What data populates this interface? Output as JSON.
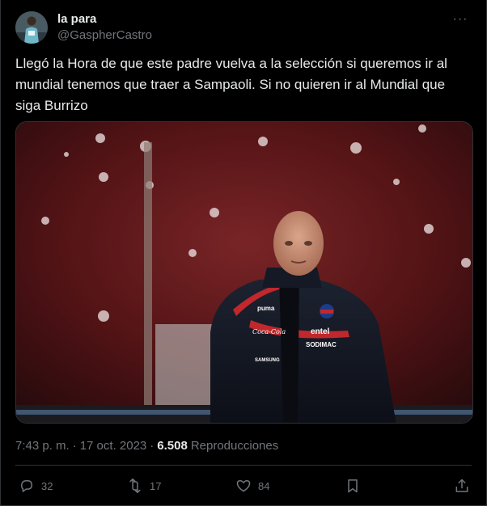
{
  "author": {
    "display_name": "la para",
    "handle": "@GaspherCastro"
  },
  "icons": {
    "more": "more-horizontal-icon",
    "reply": "reply-icon",
    "retweet": "retweet-icon",
    "like": "heart-icon",
    "bookmark": "bookmark-icon",
    "share": "share-icon"
  },
  "more_glyph": "···",
  "tweet": {
    "text": "Llegó la Hora de que este padre vuelva a la selección si queremos ir al mundial tenemos que traer a Sampaoli. Si no quieren ir al Mundial que siga Burrizo"
  },
  "photo": {
    "jacket_texts": [
      "entel",
      "SODIMAC",
      "Coca-Cola",
      "SAMSUNG",
      "puma"
    ]
  },
  "meta": {
    "time": "7:43 p. m.",
    "separator": "·",
    "date": "17 oct. 2023",
    "views_count": "6.508",
    "views_label": "Reproducciones"
  },
  "actions": {
    "replies": "32",
    "retweets": "17",
    "likes": "84"
  },
  "colors": {
    "background": "#000000",
    "text": "#e7e9ea",
    "secondary": "#71767b",
    "border": "#2f3336"
  }
}
